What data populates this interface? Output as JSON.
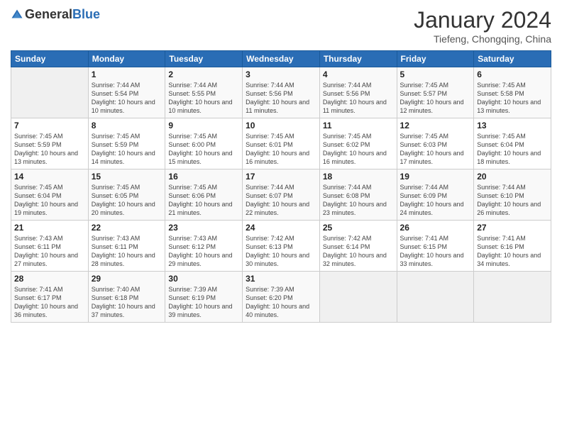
{
  "logo": {
    "general": "General",
    "blue": "Blue"
  },
  "title": "January 2024",
  "subtitle": "Tiefeng, Chongqing, China",
  "days_header": [
    "Sunday",
    "Monday",
    "Tuesday",
    "Wednesday",
    "Thursday",
    "Friday",
    "Saturday"
  ],
  "weeks": [
    [
      {
        "day": "",
        "info": ""
      },
      {
        "day": "1",
        "info": "Sunrise: 7:44 AM\nSunset: 5:54 PM\nDaylight: 10 hours and 10 minutes."
      },
      {
        "day": "2",
        "info": "Sunrise: 7:44 AM\nSunset: 5:55 PM\nDaylight: 10 hours and 10 minutes."
      },
      {
        "day": "3",
        "info": "Sunrise: 7:44 AM\nSunset: 5:56 PM\nDaylight: 10 hours and 11 minutes."
      },
      {
        "day": "4",
        "info": "Sunrise: 7:44 AM\nSunset: 5:56 PM\nDaylight: 10 hours and 11 minutes."
      },
      {
        "day": "5",
        "info": "Sunrise: 7:45 AM\nSunset: 5:57 PM\nDaylight: 10 hours and 12 minutes."
      },
      {
        "day": "6",
        "info": "Sunrise: 7:45 AM\nSunset: 5:58 PM\nDaylight: 10 hours and 13 minutes."
      }
    ],
    [
      {
        "day": "7",
        "info": "Sunrise: 7:45 AM\nSunset: 5:59 PM\nDaylight: 10 hours and 13 minutes."
      },
      {
        "day": "8",
        "info": "Sunrise: 7:45 AM\nSunset: 5:59 PM\nDaylight: 10 hours and 14 minutes."
      },
      {
        "day": "9",
        "info": "Sunrise: 7:45 AM\nSunset: 6:00 PM\nDaylight: 10 hours and 15 minutes."
      },
      {
        "day": "10",
        "info": "Sunrise: 7:45 AM\nSunset: 6:01 PM\nDaylight: 10 hours and 16 minutes."
      },
      {
        "day": "11",
        "info": "Sunrise: 7:45 AM\nSunset: 6:02 PM\nDaylight: 10 hours and 16 minutes."
      },
      {
        "day": "12",
        "info": "Sunrise: 7:45 AM\nSunset: 6:03 PM\nDaylight: 10 hours and 17 minutes."
      },
      {
        "day": "13",
        "info": "Sunrise: 7:45 AM\nSunset: 6:04 PM\nDaylight: 10 hours and 18 minutes."
      }
    ],
    [
      {
        "day": "14",
        "info": "Sunrise: 7:45 AM\nSunset: 6:04 PM\nDaylight: 10 hours and 19 minutes."
      },
      {
        "day": "15",
        "info": "Sunrise: 7:45 AM\nSunset: 6:05 PM\nDaylight: 10 hours and 20 minutes."
      },
      {
        "day": "16",
        "info": "Sunrise: 7:45 AM\nSunset: 6:06 PM\nDaylight: 10 hours and 21 minutes."
      },
      {
        "day": "17",
        "info": "Sunrise: 7:44 AM\nSunset: 6:07 PM\nDaylight: 10 hours and 22 minutes."
      },
      {
        "day": "18",
        "info": "Sunrise: 7:44 AM\nSunset: 6:08 PM\nDaylight: 10 hours and 23 minutes."
      },
      {
        "day": "19",
        "info": "Sunrise: 7:44 AM\nSunset: 6:09 PM\nDaylight: 10 hours and 24 minutes."
      },
      {
        "day": "20",
        "info": "Sunrise: 7:44 AM\nSunset: 6:10 PM\nDaylight: 10 hours and 26 minutes."
      }
    ],
    [
      {
        "day": "21",
        "info": "Sunrise: 7:43 AM\nSunset: 6:11 PM\nDaylight: 10 hours and 27 minutes."
      },
      {
        "day": "22",
        "info": "Sunrise: 7:43 AM\nSunset: 6:11 PM\nDaylight: 10 hours and 28 minutes."
      },
      {
        "day": "23",
        "info": "Sunrise: 7:43 AM\nSunset: 6:12 PM\nDaylight: 10 hours and 29 minutes."
      },
      {
        "day": "24",
        "info": "Sunrise: 7:42 AM\nSunset: 6:13 PM\nDaylight: 10 hours and 30 minutes."
      },
      {
        "day": "25",
        "info": "Sunrise: 7:42 AM\nSunset: 6:14 PM\nDaylight: 10 hours and 32 minutes."
      },
      {
        "day": "26",
        "info": "Sunrise: 7:41 AM\nSunset: 6:15 PM\nDaylight: 10 hours and 33 minutes."
      },
      {
        "day": "27",
        "info": "Sunrise: 7:41 AM\nSunset: 6:16 PM\nDaylight: 10 hours and 34 minutes."
      }
    ],
    [
      {
        "day": "28",
        "info": "Sunrise: 7:41 AM\nSunset: 6:17 PM\nDaylight: 10 hours and 36 minutes."
      },
      {
        "day": "29",
        "info": "Sunrise: 7:40 AM\nSunset: 6:18 PM\nDaylight: 10 hours and 37 minutes."
      },
      {
        "day": "30",
        "info": "Sunrise: 7:39 AM\nSunset: 6:19 PM\nDaylight: 10 hours and 39 minutes."
      },
      {
        "day": "31",
        "info": "Sunrise: 7:39 AM\nSunset: 6:20 PM\nDaylight: 10 hours and 40 minutes."
      },
      {
        "day": "",
        "info": ""
      },
      {
        "day": "",
        "info": ""
      },
      {
        "day": "",
        "info": ""
      }
    ]
  ]
}
